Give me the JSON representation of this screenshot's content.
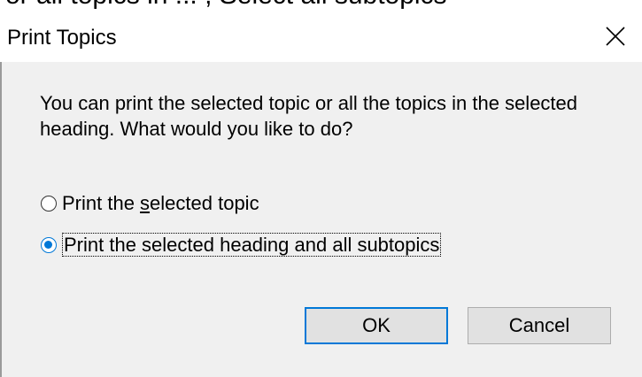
{
  "background_text": "or all topics in ... , Select all subtopics",
  "dialog": {
    "title": "Print Topics",
    "close_icon": "close-icon",
    "message": "You can print the selected topic or all the topics in the selected heading. What would you like to do?",
    "options": [
      {
        "label_pre": "Print the ",
        "label_key": "s",
        "label_post": "elected topic",
        "selected": false
      },
      {
        "label": "Print the selected heading and all subtopics",
        "selected": true
      }
    ],
    "ok_label": "OK",
    "cancel_label": "Cancel"
  },
  "colors": {
    "accent": "#0078d7",
    "dialog_bg": "#f0f0f0",
    "button_bg": "#e1e1e1"
  }
}
